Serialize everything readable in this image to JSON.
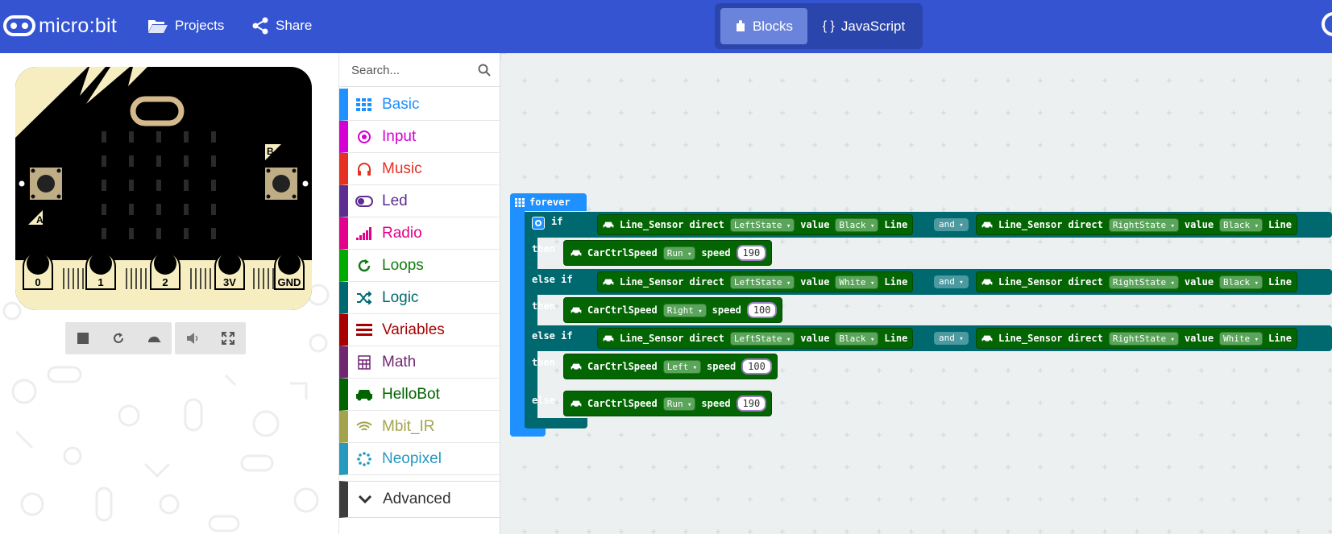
{
  "header": {
    "logo_text": "micro:bit",
    "projects_label": "Projects",
    "share_label": "Share",
    "blocks_label": "Blocks",
    "javascript_glyph": "{ }",
    "javascript_label": "JavaScript",
    "bg_color": "#3454d1"
  },
  "simulator": {
    "button_a": "A",
    "button_b": "B",
    "pins": [
      "0",
      "1",
      "2",
      "3V",
      "GND"
    ],
    "controls": [
      "stop-icon",
      "restart-icon",
      "slowmo-icon",
      "mute-icon",
      "fullscreen-icon"
    ]
  },
  "toolbox": {
    "search_placeholder": "Search...",
    "categories": [
      {
        "label": "Basic",
        "color": "#1e90ff"
      },
      {
        "label": "Input",
        "color": "#d400d4"
      },
      {
        "label": "Music",
        "color": "#e63022"
      },
      {
        "label": "Led",
        "color": "#5c2d91"
      },
      {
        "label": "Radio",
        "color": "#e3008c"
      },
      {
        "label": "Loops",
        "color": "#00aa00"
      },
      {
        "label": "Logic",
        "color": "#00a4a6"
      },
      {
        "label": "Variables",
        "color": "#dc143c"
      },
      {
        "label": "Math",
        "color": "#9400d3"
      },
      {
        "label": "HelloBot",
        "color": "#006400"
      },
      {
        "label": "Mbit_IR",
        "color": "#a3a34e"
      },
      {
        "label": "Neopixel",
        "color": "#2699bf"
      }
    ],
    "advanced_label": "Advanced"
  },
  "workspace": {
    "forever_label": "forever",
    "if_label": "if",
    "then_label": "then",
    "else_if_label": "else if",
    "else_label": "else",
    "and_label": "and",
    "sensor_label": "Line_Sensor",
    "direct_label": "direct",
    "value_label": "value",
    "line_label": "Line",
    "car_label": "CarCtrlSpeed",
    "speed_label": "speed",
    "conditions": [
      {
        "left": {
          "state": "LeftState",
          "value": "Black"
        },
        "right": {
          "state": "RightState",
          "value": "Black"
        }
      },
      {
        "left": {
          "state": "LeftState",
          "value": "White"
        },
        "right": {
          "state": "RightState",
          "value": "Black"
        }
      },
      {
        "left": {
          "state": "LeftState",
          "value": "Black"
        },
        "right": {
          "state": "RightState",
          "value": "White"
        }
      }
    ],
    "actions": [
      {
        "dir": "Run",
        "speed": "190"
      },
      {
        "dir": "Right",
        "speed": "100"
      },
      {
        "dir": "Left",
        "speed": "100"
      },
      {
        "dir": "Run",
        "speed": "190"
      }
    ]
  }
}
